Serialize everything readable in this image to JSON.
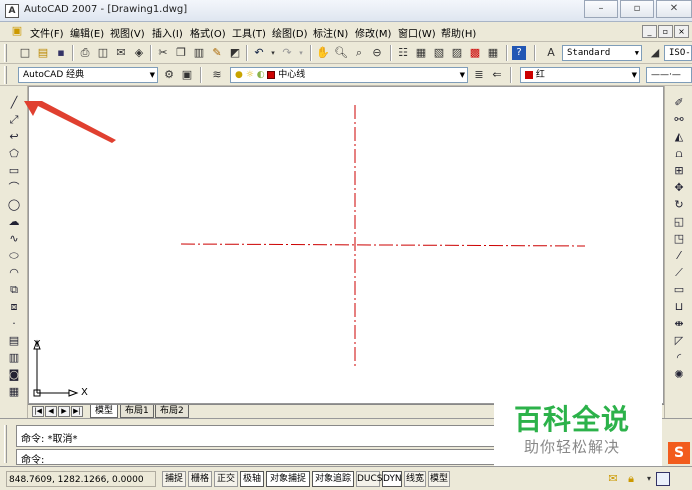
{
  "window": {
    "title": "AutoCAD 2007 - [Drawing1.dwg]",
    "app_icon": "A",
    "controls": {
      "minimize": "–",
      "maximize": "▫",
      "close": "✕"
    }
  },
  "menubar": {
    "items": [
      "文件(F)",
      "编辑(E)",
      "视图(V)",
      "插入(I)",
      "格式(O)",
      "工具(T)",
      "绘图(D)",
      "标注(N)",
      "修改(M)",
      "窗口(W)",
      "帮助(H)"
    ],
    "mdi_controls": {
      "minimize": "_",
      "restore": "▫",
      "close": "×"
    }
  },
  "toolbar1": {
    "text_style": "Standard",
    "dim_style": "ISO-"
  },
  "toolbar2": {
    "workspace": "AutoCAD 经典",
    "layer": "中心线",
    "layer_color_hex": "#cc0000",
    "color_name": "红",
    "color_hex": "#cc0000",
    "linetype": "——·—"
  },
  "canvas": {
    "ucs": {
      "x_label": "X",
      "y_label": "Y"
    },
    "centerline_color": "#cc0000"
  },
  "annotation": {
    "arrow_color": "#e04030"
  },
  "tabs": {
    "items": [
      "模型",
      "布局1",
      "布局2"
    ],
    "active": "模型"
  },
  "command": {
    "history": [
      "命令: *取消*",
      "命令:"
    ],
    "input": ""
  },
  "status": {
    "coords": "848.7609,  1282.1266, 0.0000",
    "buttons": [
      "捕捉",
      "栅格",
      "正交",
      "极轴",
      "对象捕捉",
      "对象追踪",
      "DUCS",
      "DYN",
      "线宽",
      "模型"
    ]
  },
  "watermark": {
    "title": "百科全说",
    "subtitle": "助你轻松解决",
    "color": "#2cb24a"
  },
  "badge": {
    "label": "S",
    "color": "#f25c1d"
  }
}
